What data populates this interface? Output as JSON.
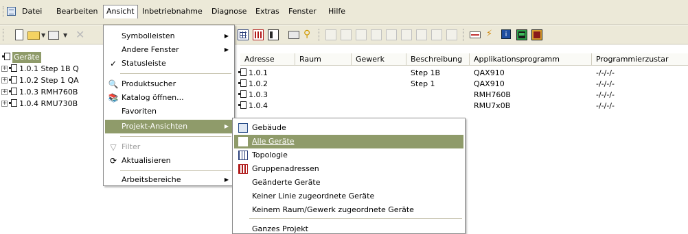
{
  "menubar": {
    "items": [
      "Datei",
      "Bearbeiten",
      "Ansicht",
      "Inbetriebnahme",
      "Diagnose",
      "Extras",
      "Fenster",
      "Hilfe"
    ]
  },
  "tree": {
    "root": "Geräte",
    "items": [
      "1.0.1 Step 1B Q",
      "1.0.2 Step 1 QA",
      "1.0.3 RMH760B",
      "1.0.4 RMU730B"
    ]
  },
  "list": {
    "columns": [
      "Adresse",
      "Raum",
      "Gewerk",
      "Beschreibung",
      "Applikationsprogramm",
      "Programmierzustar"
    ],
    "rows": [
      {
        "adresse": "1.0.1",
        "beschreibung": "Step 1B",
        "applikation": "QAX910",
        "zustand": "-/-/-/-"
      },
      {
        "adresse": "1.0.2",
        "beschreibung": "Step 1",
        "applikation": "QAX910",
        "zustand": "-/-/-/-"
      },
      {
        "adresse": "1.0.3",
        "beschreibung": "",
        "applikation": "RMH760B",
        "zustand": "-/-/-/-"
      },
      {
        "adresse": "1.0.4",
        "beschreibung": "",
        "applikation": "RMU7x0B",
        "zustand": "-/-/-/-"
      }
    ]
  },
  "ansicht_menu": {
    "items": [
      "Symbolleisten",
      "Andere Fenster",
      "Statusleiste",
      "Produktsucher",
      "Katalog öffnen...",
      "Favoriten",
      "Projekt-Ansichten",
      "Filter",
      "Aktualisieren",
      "Arbeitsbereiche"
    ]
  },
  "submenu": {
    "items": [
      "Gebäude",
      "Alle Geräte",
      "Topologie",
      "Gruppenadressen",
      "Geänderte Geräte",
      "Keiner Linie zugeordnete Geräte",
      "Keinem Raum/Gewerk zugeordnete Geräte",
      "Ganzes Projekt"
    ]
  },
  "colors": {
    "selection": "#8f9b6a",
    "chrome": "#ECE9D8"
  }
}
